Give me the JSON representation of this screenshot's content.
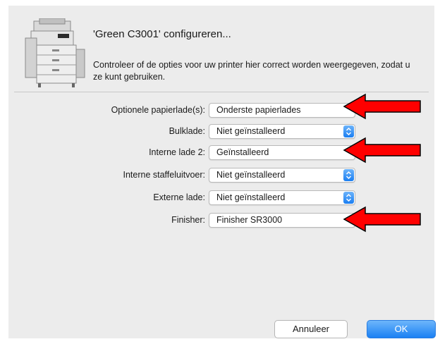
{
  "dialog": {
    "title": "'Green C3001' configureren...",
    "description": "Controleer of de opties voor uw printer hier correct worden weergegeven, zodat u ze kunt gebruiken."
  },
  "options": [
    {
      "label": "Optionele papierlade(s):",
      "value": "Onderste papierlades"
    },
    {
      "label": "Bulklade:",
      "value": "Niet geïnstalleerd"
    },
    {
      "label": "Interne lade 2:",
      "value": "Geïnstalleerd"
    },
    {
      "label": "Interne staffeluitvoer:",
      "value": "Niet geïnstalleerd"
    },
    {
      "label": "Externe lade:",
      "value": "Niet geïnstalleerd"
    },
    {
      "label": "Finisher:",
      "value": "Finisher SR3000"
    }
  ],
  "buttons": {
    "cancel": "Annuleer",
    "ok": "OK"
  },
  "colors": {
    "annotation_arrow": "#ff0000",
    "accent": "#1b80f3"
  }
}
